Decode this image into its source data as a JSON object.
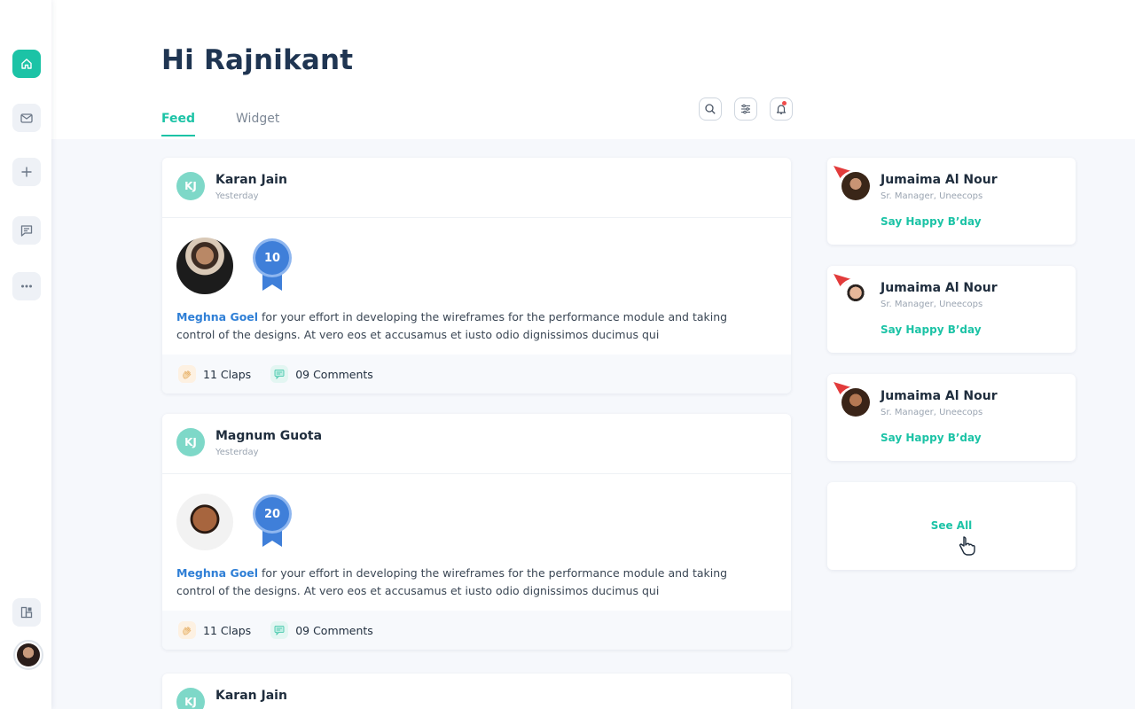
{
  "header": {
    "greeting": "Hi Rajnikant"
  },
  "tabs": [
    {
      "label": "Feed",
      "active": true
    },
    {
      "label": "Widget",
      "active": false
    }
  ],
  "toolbar": {
    "icons": [
      "search-icon",
      "filter-icon",
      "notification-bell-icon"
    ]
  },
  "sidebar": {
    "items": [
      "home-icon",
      "mail-icon",
      "add-icon",
      "chat-icon",
      "more-icon"
    ],
    "bottom": [
      "widgets-icon",
      "user-avatar"
    ]
  },
  "feed": [
    {
      "initials": "KJ",
      "author": "Karan Jain",
      "time": "Yesterday",
      "badge": "10",
      "mention": "Meghna Goel",
      "text": " for your effort in developing the wireframes for the performance module and taking control of the designs. At vero eos et accusamus et iusto odio dignissimos ducimus qui",
      "claps": "11 Claps",
      "comments": "09 Comments"
    },
    {
      "initials": "KJ",
      "author": "Magnum Guota",
      "time": "Yesterday",
      "badge": "20",
      "mention": "Meghna Goel",
      "text": " for your effort in developing the wireframes for the performance module and taking control of the designs. At vero eos et accusamus et iusto odio dignissimos ducimus qui",
      "claps": "11 Claps",
      "comments": "09 Comments"
    },
    {
      "initials": "KJ",
      "author": "Karan Jain"
    }
  ],
  "birthdays": [
    {
      "name": "Jumaima Al Nour",
      "role": "Sr. Manager, Uneecops",
      "action": "Say Happy B’day"
    },
    {
      "name": "Jumaima Al Nour",
      "role": "Sr. Manager, Uneecops",
      "action": "Say Happy B’day"
    },
    {
      "name": "Jumaima Al Nour",
      "role": "Sr. Manager, Uneecops",
      "action": "Say Happy B’day"
    }
  ],
  "see_all": "See All",
  "colors": {
    "accent": "#1cc3a6",
    "mention": "#2f7fd6",
    "badge": "#3f7fd9",
    "title": "#1f3552"
  }
}
